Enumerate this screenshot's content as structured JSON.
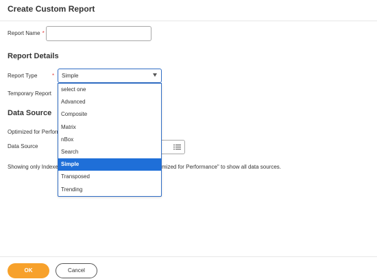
{
  "page": {
    "title": "Create Custom Report"
  },
  "form": {
    "report_name_label": "Report Name",
    "required_mark": "*",
    "report_name_value": ""
  },
  "report_details": {
    "title": "Report Details",
    "report_type_label": "Report Type",
    "report_type_value": "Simple",
    "temporary_report_label": "Temporary Report",
    "options": [
      "select one",
      "Advanced",
      "Composite",
      "Matrix",
      "nBox",
      "Search",
      "Simple",
      "Transposed",
      "Trending"
    ],
    "selected_option": "Simple"
  },
  "data_source": {
    "title": "Data Source",
    "optimized_label": "Optimized for Perform",
    "data_source_label": "Data Source",
    "info_text_start": "Showing only Indexe",
    "info_text_end": "mized for Performance\" to show all data sources."
  },
  "footer": {
    "ok_label": "OK",
    "cancel_label": "Cancel"
  },
  "colors": {
    "accent_blue": "#1f6fd8",
    "ok_orange": "#f7a12b",
    "required_red": "#e23d3d"
  },
  "icons": {
    "select_arrow": "chevron-down-icon",
    "prompt": "list-prompt-icon"
  }
}
